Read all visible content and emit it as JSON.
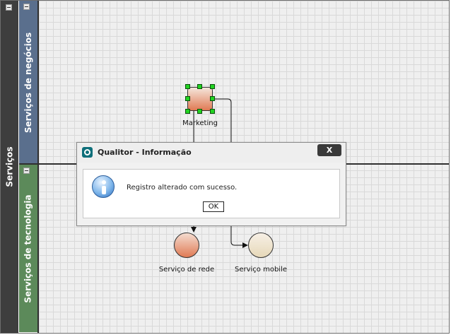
{
  "pool": {
    "label": "Serviços"
  },
  "lanes": [
    {
      "label": "Serviços de negócios"
    },
    {
      "label": "Serviços de tecnologia"
    }
  ],
  "nodes": {
    "task": {
      "label": "Marketing"
    },
    "service_network": {
      "label": "Serviço de rede"
    },
    "service_mobile": {
      "label": "Serviço mobile"
    }
  },
  "dialog": {
    "title": "Qualitor - Informação",
    "close_label": "X",
    "message": "Registro alterado com sucesso.",
    "ok_label": "OK"
  },
  "colors": {
    "pool": "#3e3e3e",
    "lane_business": "#5a6f8d",
    "lane_technology": "#5c8a5a",
    "selection_handle": "#21d321"
  }
}
